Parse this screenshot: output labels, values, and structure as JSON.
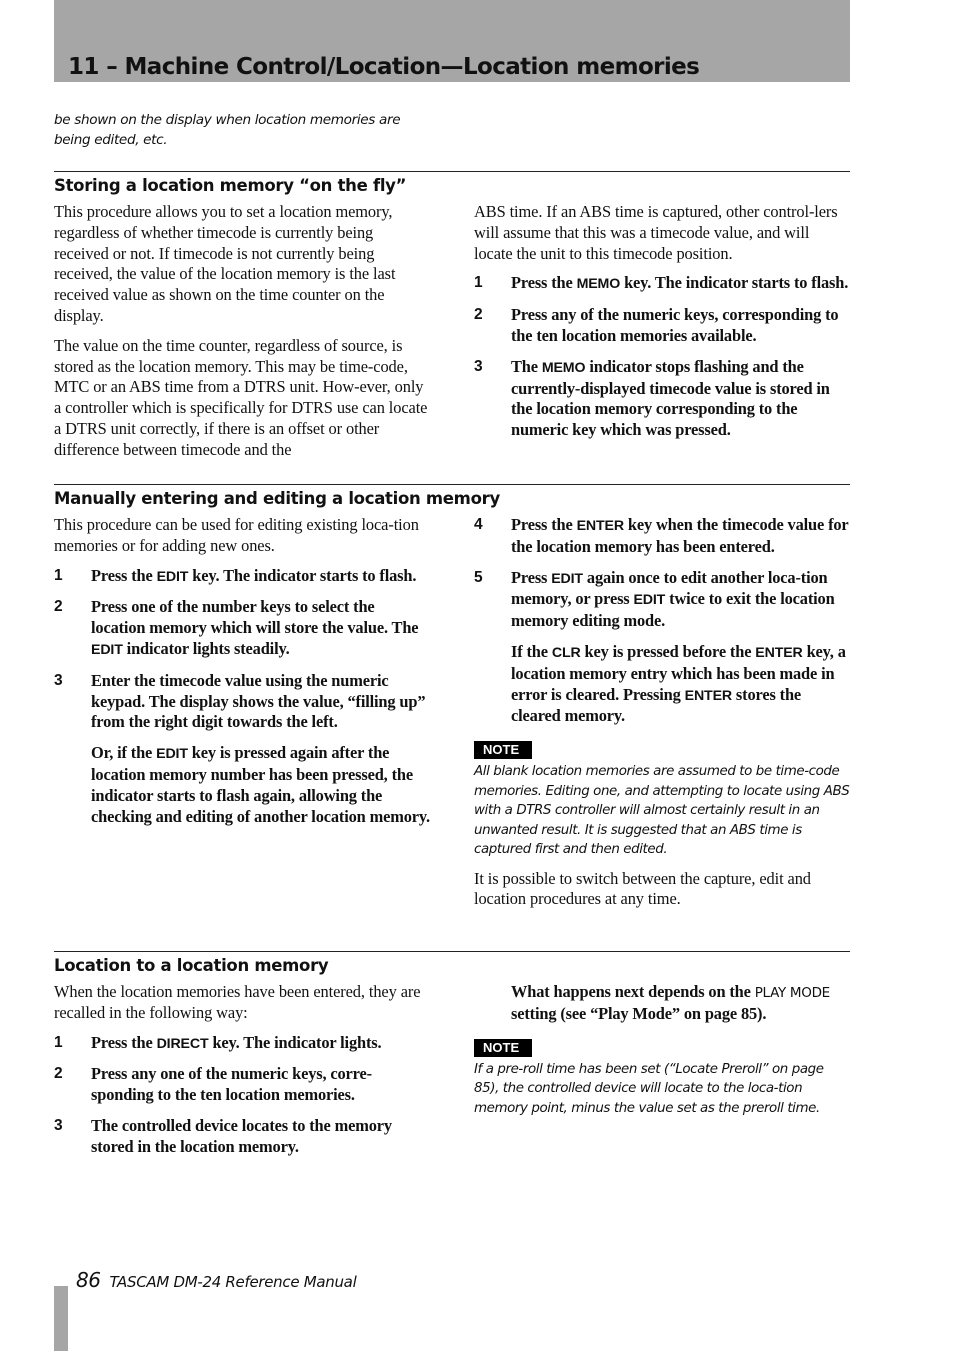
{
  "header": {
    "chapter_title": "11 – Machine Control/Location—Location memories"
  },
  "carry_over_text": "be shown on the display when location memories are being edited, etc.",
  "sections": {
    "on_the_fly": {
      "title": "Storing a location memory “on the fly”",
      "paragraphs": [
        "This procedure allows you to set a location memory, regardless of whether timecode is currently being received or not. If timecode is not currently being received, the value of the location memory is the last received value as shown on the time counter on the display.",
        "The value on the time counter, regardless of source, is stored as the location memory. This may be time-code, MTC or an ABS time from a DTRS unit. However, only a controller which is specifically for DTRS use can locate a DTRS unit correctly, if there is an offset or other difference between timecode and the ABS time. If an ABS time is captured, other controllers will assume that this was a timecode value, and will locate the unit to this timecode position."
      ],
      "paragraph_2_left": "The value on the time counter, regardless of source, is stored as the location memory. This may be time-code, MTC or an ABS time from a DTRS unit. How-ever, only a controller which is specifically for DTRS use can locate a DTRS unit correctly, if there is an offset or other difference between timecode and the",
      "paragraph_2_right": "ABS time. If an ABS time is captured, other control-lers will assume that this was a timecode value, and will locate the unit to this timecode position.",
      "steps": [
        {
          "num": "1",
          "pre": "Press the ",
          "key": "MEMO",
          "post": " key. The indicator starts to flash."
        },
        {
          "num": "2",
          "pre": "Press any of the numeric keys, corresponding to the ten location memories available.",
          "key": "",
          "post": ""
        },
        {
          "num": "3",
          "pre": "The ",
          "key": "MEMO",
          "post": " indicator stops flashing and the currently-displayed timecode value is stored in the location memory corresponding to the numeric key which was pressed."
        }
      ]
    },
    "manual_edit": {
      "title": "Manually entering and editing a location memory",
      "intro": "This procedure can be used for editing existing loca-tion memories or for adding new ones.",
      "steps": [
        {
          "num": "1",
          "pre": "Press the ",
          "key": "EDIT",
          "post": " key. The indicator starts to flash."
        },
        {
          "num": "2",
          "pre": "Press one of the number keys to select the location memory which will store the value. The ",
          "key": "EDIT",
          "post": " indicator lights steadily."
        },
        {
          "num": "3",
          "pre": "Enter the timecode value using the numeric keypad. The display shows the value, “filling up” from the right digit towards the left.",
          "key": "",
          "post": ""
        },
        {
          "num": "4",
          "pre": "Press the ",
          "key": "ENTER",
          "post": " key when the timecode value for the location memory has been entered."
        },
        {
          "num": "5",
          "pre": "Press ",
          "key": "EDIT",
          "mid": " again once to edit another loca-tion memory, or press ",
          "key2": "EDIT",
          "post": " twice to exit the location memory editing mode."
        }
      ],
      "step3_followup": {
        "pre": "Or, if the ",
        "key": "EDIT",
        "post": " key is pressed again after the location memory number has been pressed, the indicator starts to flash again, allowing the checking and editing of another location memory."
      },
      "step5_followup": {
        "pre": "If the ",
        "key": "CLR",
        "mid": " key is pressed before the ",
        "key2": "ENTER",
        "mid2": " key, a location memory entry which has been made in error is cleared. Pressing ",
        "key3": "ENTER",
        "post": " stores the cleared memory."
      },
      "note_label": "NOTE",
      "note_text": "All blank location memories are assumed to be time-code memories. Editing one, and attempting to locate using ABS with a DTRS controller will almost certainly result in an unwanted result. It is suggested that an ABS time is captured first and then edited.",
      "closing": "It is possible to switch between the capture, edit and location procedures at any time."
    },
    "locate": {
      "title": "Location to a location memory",
      "intro": "When the location memories have been entered, they are recalled in the following way:",
      "steps": [
        {
          "num": "1",
          "pre": "Press the ",
          "key": "DIRECT",
          "post": " key. The indicator lights."
        },
        {
          "num": "2",
          "pre": "Press any one of the numeric keys, corre-sponding to the ten location memories.",
          "key": "",
          "post": ""
        },
        {
          "num": "3",
          "pre": "The controlled device locates to the memory stored in the location memory.",
          "key": "",
          "post": ""
        }
      ],
      "followup": {
        "pre": "What happens next depends on the ",
        "key": "PLAY MODE",
        "post": " setting (see “Play Mode” on page 85)."
      },
      "note_label": "NOTE",
      "note_text": "If a pre-roll time has been set (“Locate Preroll” on page 85), the controlled device will locate to the loca-tion memory point, minus the value set as the preroll time."
    }
  },
  "footer": {
    "page_number": "86",
    "manual_title": "TASCAM DM-24 Reference Manual"
  },
  "colors": {
    "header_band": "#a6a6a6",
    "note_badge_bg": "#000000",
    "note_badge_text": "#ffffff"
  }
}
